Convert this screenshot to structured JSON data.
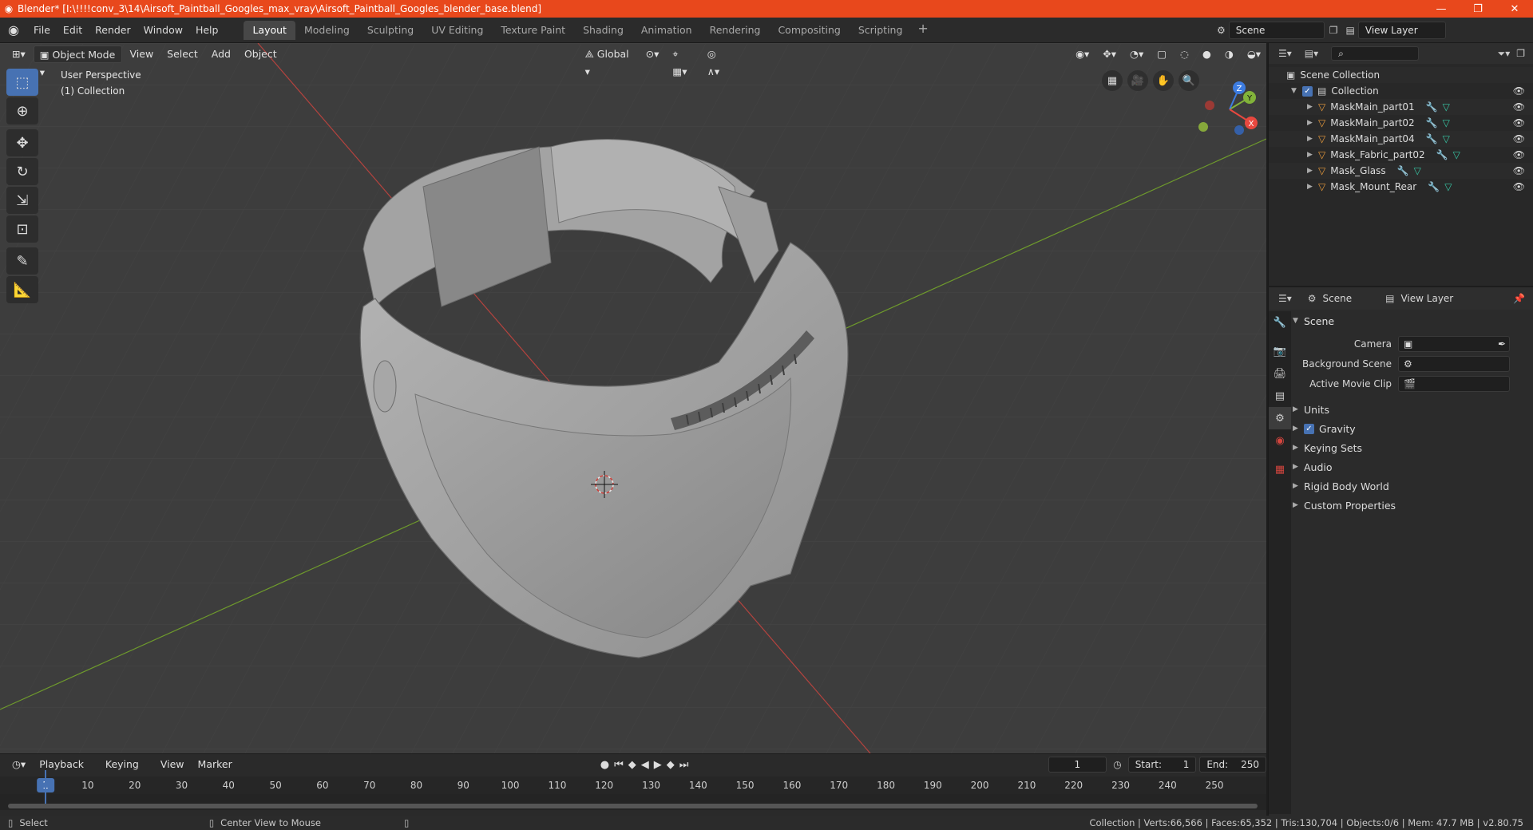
{
  "window": {
    "title": "Blender* [I:\\!!!!conv_3\\14\\Airsoft_Paintball_Googles_max_vray\\Airsoft_Paintball_Googles_blender_base.blend]",
    "minimize": "—",
    "maximize": "❐",
    "close": "✕"
  },
  "menu": [
    "File",
    "Edit",
    "Render",
    "Window",
    "Help"
  ],
  "workspaces": [
    "Layout",
    "Modeling",
    "Sculpting",
    "UV Editing",
    "Texture Paint",
    "Shading",
    "Animation",
    "Rendering",
    "Compositing",
    "Scripting"
  ],
  "active_workspace": "Layout",
  "scene_selector": {
    "scene": "Scene",
    "view_layer": "View Layer"
  },
  "viewport": {
    "mode": "Object Mode",
    "menus": [
      "View",
      "Select",
      "Add",
      "Object"
    ],
    "transform_orientation": "Global",
    "info_line1": "User Perspective",
    "info_line2": "(1) Collection",
    "gizmo_axes": {
      "x": "X",
      "y": "Y",
      "z": "Z"
    }
  },
  "timeline": {
    "menus": [
      "Playback",
      "Keying",
      "View",
      "Marker"
    ],
    "current_frame": "1",
    "start_label": "Start:",
    "start": "1",
    "end_label": "End:",
    "end": "250",
    "ruler": [
      "1",
      "10",
      "20",
      "30",
      "40",
      "50",
      "60",
      "70",
      "80",
      "90",
      "100",
      "110",
      "120",
      "130",
      "140",
      "150",
      "160",
      "170",
      "180",
      "190",
      "200",
      "210",
      "220",
      "230",
      "240",
      "250"
    ]
  },
  "statusbar": {
    "left1": "Select",
    "left2": "Center View to Mouse",
    "right": "Collection | Verts:66,566 | Faces:65,352 | Tris:130,704 | Objects:0/6 | Mem: 47.7 MB | v2.80.75"
  },
  "outliner": {
    "root": "Scene Collection",
    "collection": "Collection",
    "objects": [
      "MaskMain_part01",
      "MaskMain_part02",
      "MaskMain_part04",
      "Mask_Fabric_part02",
      "Mask_Glass",
      "Mask_Mount_Rear"
    ]
  },
  "properties": {
    "header_scene": "Scene",
    "header_view_layer": "View Layer",
    "section": "Scene",
    "camera_label": "Camera",
    "background_scene_label": "Background Scene",
    "active_movie_clip_label": "Active Movie Clip",
    "subsections": [
      "Units",
      "Gravity",
      "Keying Sets",
      "Audio",
      "Rigid Body World",
      "Custom Properties"
    ],
    "gravity_checked": true
  },
  "colors": {
    "titlebar": "#e8481c",
    "accent": "#4772b3",
    "viewport_bg": "#3d3d3d",
    "x_axis": "#e8483f",
    "y_axis": "#82b33a",
    "z_axis": "#3d7ce0"
  }
}
